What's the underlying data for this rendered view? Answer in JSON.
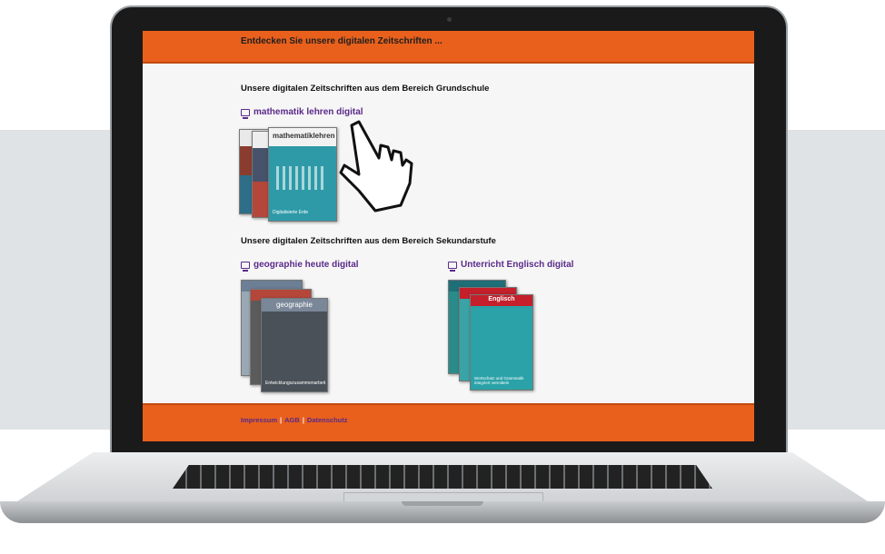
{
  "header": {
    "title": "Entdecken Sie unsere digitalen Zeitschriften ..."
  },
  "sections": [
    {
      "title": "Unsere digitalen Zeitschriften aus dem Bereich Grundschule",
      "magazines": [
        {
          "label": "mathematik lehren digital",
          "cover_title": "mathematiklehren",
          "cover_subtitle": "Digitalisierte Erde"
        }
      ]
    },
    {
      "title": "Unsere digitalen Zeitschriften aus dem Bereich Sekundarstufe",
      "magazines": [
        {
          "label": "geographie heute digital",
          "cover_title": "geographie",
          "cover_subtitle": "Entwicklungs­zusammenarbeit"
        },
        {
          "label": "Unterricht Englisch digital",
          "cover_title": "Englisch",
          "cover_subtitle": "Wortschatz und Grammatik integriert vermitteln"
        }
      ]
    }
  ],
  "footer": {
    "links": [
      "Impressum",
      "AGB",
      "Datenschutz"
    ],
    "separator": "|"
  },
  "icons": {
    "magazine_link_icon": "monitor-icon",
    "cursor": "pointing-hand-cursor-icon"
  },
  "colors": {
    "accent_orange": "#e8601c",
    "link_purple": "#5a2a8a"
  }
}
